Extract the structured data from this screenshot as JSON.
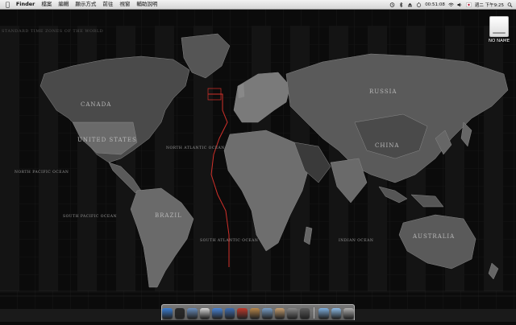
{
  "menubar": {
    "apple_icon": "apple-icon",
    "app": "Finder",
    "items": [
      "檔案",
      "編輯",
      "顯示方式",
      "前往",
      "視窗",
      "輔助說明"
    ],
    "clock": "00:51:08",
    "datetime": "週二 下午9:25"
  },
  "wallpaper": {
    "title": "STANDARD TIME ZONES OF THE WORLD",
    "regions": [
      "CANADA",
      "UNITED STATES",
      "RUSSIA",
      "CHINA",
      "AUSTRALIA",
      "BRAZIL",
      "NORTH PACIFIC OCEAN",
      "SOUTH PACIFIC OCEAN",
      "NORTH ATLANTIC OCEAN",
      "SOUTH ATLANTIC OCEAN",
      "INDIAN OCEAN"
    ]
  },
  "desktop": {
    "drive_label": "NO NAME"
  },
  "dock": {
    "icons": [
      {
        "name": "finder-icon",
        "color": "#3b7fd6"
      },
      {
        "name": "dashboard-icon",
        "color": "#2b2b2b"
      },
      {
        "name": "mail-icon",
        "color": "#6a8fbf"
      },
      {
        "name": "ical-icon",
        "color": "#d8d8d8"
      },
      {
        "name": "ichat-icon",
        "color": "#4a86d8"
      },
      {
        "name": "itunes-icon",
        "color": "#3d6fb5"
      },
      {
        "name": "photo-booth-icon",
        "color": "#c0392b"
      },
      {
        "name": "addressbook-icon",
        "color": "#b9884a"
      },
      {
        "name": "iphoto-icon",
        "color": "#7aa0c8"
      },
      {
        "name": "preview-icon",
        "color": "#c8a070"
      },
      {
        "name": "system-preferences-icon",
        "color": "#8a8a8a"
      },
      {
        "name": "activity-icon",
        "color": "#5d5d5d"
      },
      {
        "name": "applications-folder-icon",
        "color": "#7fb0e0"
      },
      {
        "name": "documents-folder-icon",
        "color": "#8ebce6"
      },
      {
        "name": "trash-icon",
        "color": "#b0b0b0"
      }
    ]
  }
}
